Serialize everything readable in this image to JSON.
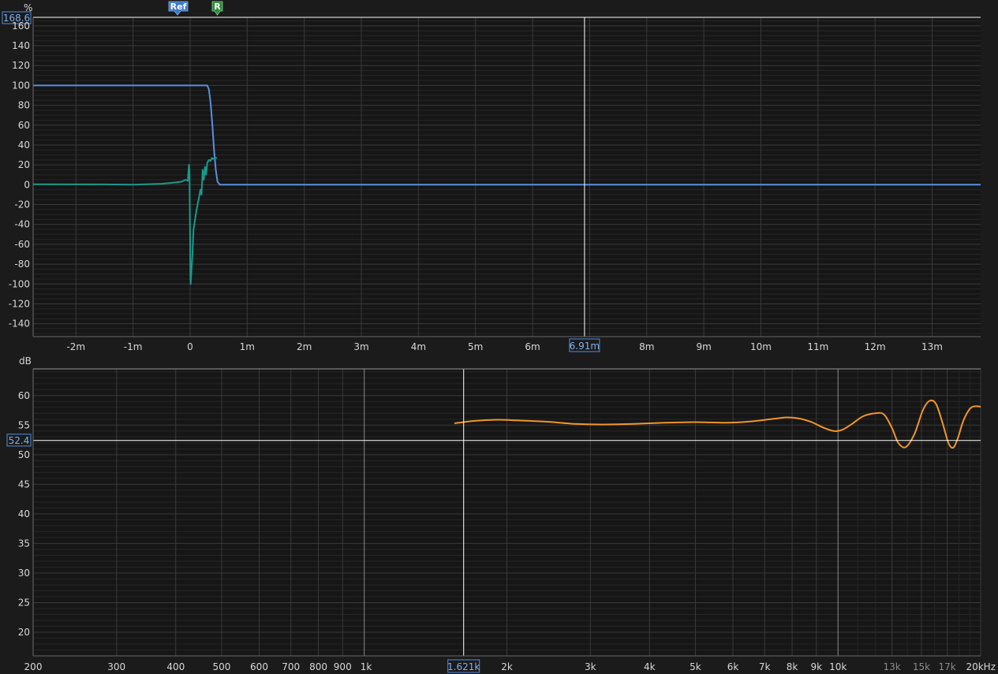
{
  "colors": {
    "background": "#1b1b1b",
    "plot_bg": "#161616",
    "grid_major": "#3a3a3a",
    "grid_minor": "#262626",
    "cursor": "#ffffff",
    "step_response": "#5b8fe0",
    "impulse_response": "#1a9a8c",
    "spl": "#f0962a",
    "ref_marker": "#3a78c8",
    "r_marker": "#2e8b3a"
  },
  "markers": {
    "ref_label": "Ref",
    "r_label": "R"
  },
  "chart_data": [
    {
      "type": "line",
      "name": "impulse-step-graph",
      "ylabel": "%",
      "xlim": [
        -2.75,
        13.85
      ],
      "ylim": [
        -153,
        168.6
      ],
      "x_ticks": [
        {
          "v": -2,
          "label": "-2m"
        },
        {
          "v": -1,
          "label": "-1m"
        },
        {
          "v": 0,
          "label": "0"
        },
        {
          "v": 1,
          "label": "1m"
        },
        {
          "v": 2,
          "label": "2m"
        },
        {
          "v": 3,
          "label": "3m"
        },
        {
          "v": 4,
          "label": "4m"
        },
        {
          "v": 5,
          "label": "5m"
        },
        {
          "v": 6,
          "label": "6m"
        },
        {
          "v": 8,
          "label": "8m"
        },
        {
          "v": 9,
          "label": "9m"
        },
        {
          "v": 10,
          "label": "10m"
        },
        {
          "v": 11,
          "label": "11m"
        },
        {
          "v": 12,
          "label": "12m"
        },
        {
          "v": 13,
          "label": "13m"
        }
      ],
      "y_ticks": [
        160,
        140,
        120,
        100,
        80,
        60,
        40,
        20,
        0,
        -20,
        -40,
        -60,
        -80,
        -100,
        -120,
        -140
      ],
      "cursor_x": 6.91,
      "cursor_x_label": "6.91m",
      "cursor_y_label": "168.6",
      "series": [
        {
          "role": "step",
          "color": "#5b8fe0",
          "x": [
            -2.75,
            0.0,
            0.3,
            0.33,
            0.36,
            0.39,
            0.42,
            0.45,
            0.48,
            0.52,
            13.85
          ],
          "y": [
            100,
            100,
            100,
            96,
            82,
            60,
            35,
            15,
            3,
            0,
            0
          ]
        },
        {
          "role": "impulse",
          "color": "#1a9a8c",
          "x": [
            -2.75,
            -1.5,
            -1.0,
            -0.5,
            -0.3,
            -0.15,
            -0.08,
            -0.04,
            -0.02,
            -0.01,
            0.0,
            0.005,
            0.01,
            0.02,
            0.04,
            0.06,
            0.08,
            0.1,
            0.13,
            0.16,
            0.18,
            0.2,
            0.22,
            0.24,
            0.26,
            0.28,
            0.3,
            0.33,
            0.36,
            0.38,
            0.4,
            0.43,
            0.45,
            0.47
          ],
          "y": [
            0.5,
            0.3,
            0,
            1,
            2,
            3,
            5,
            4,
            20,
            10,
            -60,
            -95,
            -100,
            -90,
            -70,
            -45,
            -38,
            -30,
            -20,
            -12,
            -5,
            -10,
            15,
            5,
            18,
            10,
            22,
            25,
            24,
            27,
            26,
            27,
            27,
            27
          ]
        }
      ]
    },
    {
      "type": "line",
      "name": "spl-graph",
      "ylabel": "dB",
      "xscale": "log",
      "xlim": [
        200,
        20000
      ],
      "ylim": [
        16,
        64.5
      ],
      "x_ticks": [
        {
          "v": 200,
          "label": "200"
        },
        {
          "v": 300,
          "label": "300"
        },
        {
          "v": 400,
          "label": "400"
        },
        {
          "v": 500,
          "label": "500"
        },
        {
          "v": 600,
          "label": "600"
        },
        {
          "v": 700,
          "label": "700"
        },
        {
          "v": 800,
          "label": "800"
        },
        {
          "v": 900,
          "label": "900"
        },
        {
          "v": 1000,
          "label": "1k"
        },
        {
          "v": 2000,
          "label": "2k"
        },
        {
          "v": 3000,
          "label": "3k"
        },
        {
          "v": 4000,
          "label": "4k"
        },
        {
          "v": 5000,
          "label": "5k"
        },
        {
          "v": 6000,
          "label": "6k"
        },
        {
          "v": 7000,
          "label": "7k"
        },
        {
          "v": 8000,
          "label": "8k"
        },
        {
          "v": 9000,
          "label": "9k"
        },
        {
          "v": 10000,
          "label": "10k"
        },
        {
          "v": 13000,
          "label": "13k",
          "dim": true
        },
        {
          "v": 15000,
          "label": "15k",
          "dim": true
        },
        {
          "v": 17000,
          "label": "17k",
          "dim": true
        },
        {
          "v": 20000,
          "label": "20kHz"
        }
      ],
      "y_ticks": [
        60,
        55,
        50,
        45,
        40,
        35,
        30,
        25,
        20
      ],
      "cursor_x": 1621,
      "cursor_x_label": "1.621k",
      "cursor_y": 52.4,
      "cursor_y_label": "52.4",
      "series": [
        {
          "role": "spl",
          "color": "#f0962a",
          "x": [
            1550,
            1700,
            1900,
            2100,
            2400,
            2800,
            3200,
            3700,
            4300,
            5000,
            5800,
            6500,
            7200,
            7800,
            8300,
            8800,
            9300,
            9800,
            10200,
            10700,
            11300,
            12000,
            12500,
            13000,
            13400,
            13900,
            14500,
            15100,
            15600,
            16100,
            16600,
            17100,
            17500,
            17900,
            18400,
            19000,
            19500,
            20000
          ],
          "y": [
            55.3,
            55.7,
            55.9,
            55.8,
            55.6,
            55.2,
            55.1,
            55.2,
            55.4,
            55.5,
            55.4,
            55.6,
            56.0,
            56.3,
            56.1,
            55.5,
            54.6,
            54.0,
            54.2,
            55.2,
            56.5,
            57.0,
            56.8,
            54.5,
            52.0,
            51.3,
            53.5,
            57.5,
            59.1,
            58.6,
            55.5,
            52.0,
            51.2,
            52.8,
            55.8,
            57.8,
            58.2,
            58.1
          ]
        }
      ]
    }
  ]
}
